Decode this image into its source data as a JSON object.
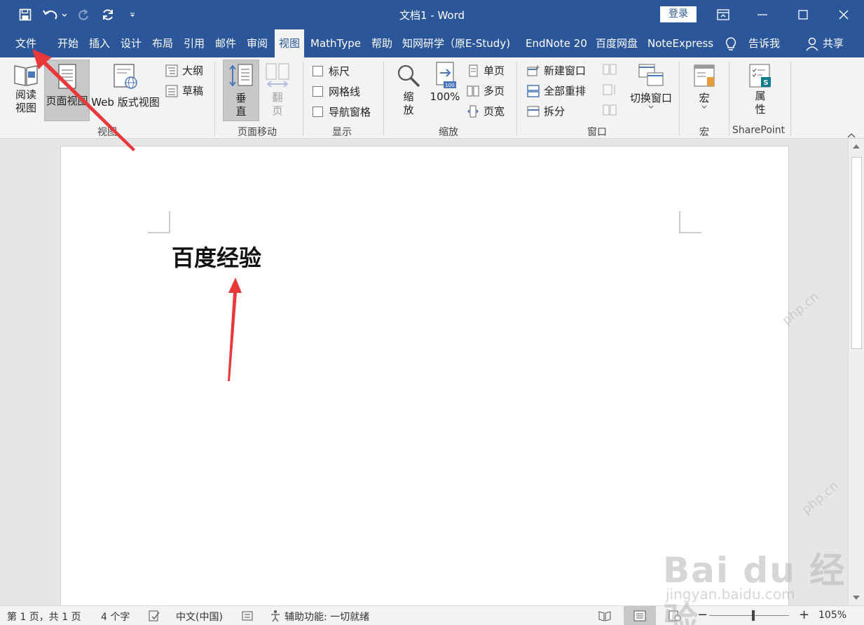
{
  "window": {
    "title": "文档1  -  Word",
    "signin_label": "登录"
  },
  "tabs": [
    {
      "label": "文件"
    },
    {
      "label": "开始"
    },
    {
      "label": "插入"
    },
    {
      "label": "设计"
    },
    {
      "label": "布局"
    },
    {
      "label": "引用"
    },
    {
      "label": "邮件"
    },
    {
      "label": "审阅"
    },
    {
      "label": "视图",
      "active": true
    },
    {
      "label": "MathType"
    },
    {
      "label": "帮助"
    },
    {
      "label": "知网研学（原E-Study)"
    },
    {
      "label": "EndNote 20"
    },
    {
      "label": "百度网盘"
    },
    {
      "label": "NoteExpress"
    },
    {
      "label": "告诉我"
    },
    {
      "label": "共享"
    }
  ],
  "ribbon": {
    "views": {
      "read_mode": "阅读\n视图",
      "print_layout": "页面视图",
      "web_layout": "Web 版式视图",
      "outline": "大纲",
      "draft": "草稿",
      "group_label": "视图"
    },
    "page_movement": {
      "vertical": "垂\n直",
      "side_to_side": "翻\n页",
      "group_label": "页面移动"
    },
    "show": {
      "ruler": "标尺",
      "gridlines": "网格线",
      "navigation_pane": "导航窗格",
      "group_label": "显示"
    },
    "zoom": {
      "zoom": "缩\n放",
      "hundred": "100%",
      "one_page": "单页",
      "multiple_pages": "多页",
      "page_width": "页宽",
      "group_label": "缩放"
    },
    "window": {
      "new_window": "新建窗口",
      "arrange_all": "全部重排",
      "split": "拆分",
      "switch_windows": "切换窗口",
      "group_label": "窗口"
    },
    "macros": {
      "macros": "宏",
      "group_label": "宏"
    },
    "sharepoint": {
      "properties": "属\n性",
      "group_label": "SharePoint"
    }
  },
  "document": {
    "heading": "百度经验"
  },
  "statusbar": {
    "page": "第 1 页，共 1 页",
    "words": "4 个字",
    "language": "中文(中国)",
    "accessibility": "辅助功能: 一切就绪",
    "zoom": "105%"
  },
  "watermark": {
    "brand": "Bai du 经验",
    "url": "jingyan.baidu.com",
    "site": "php.cn"
  },
  "colors": {
    "title_bar": "#2b579a",
    "ribbon": "#f3f3f3",
    "annotation_arrow": "#e8383a"
  }
}
